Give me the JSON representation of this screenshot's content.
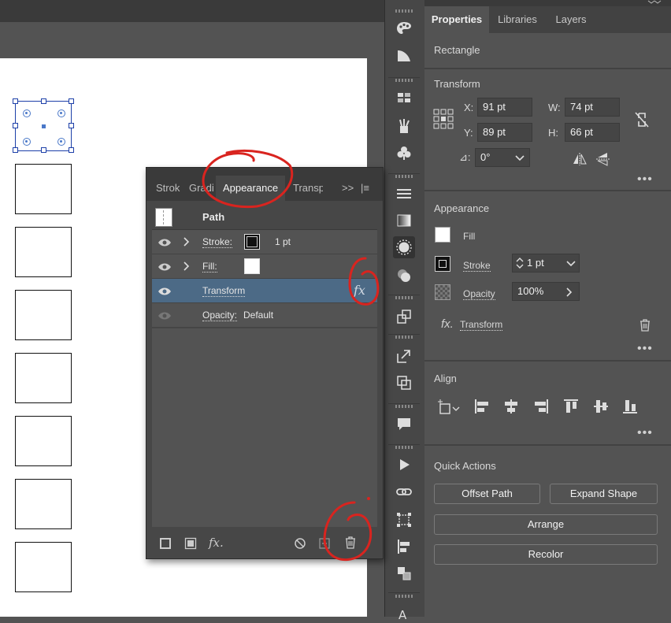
{
  "toolbar": {
    "icons": [
      "paint-palette-icon",
      "gradient-swatch-icon",
      "artboard-grid-icon",
      "brushes-icon",
      "symbols-icon",
      "align-lines-icon",
      "gradient-icon",
      "appearance-icon",
      "graphic-styles-icon",
      "transform-icon",
      "export-icon",
      "pathfinder-icon",
      "comment-icon",
      "play-icon",
      "links-icon",
      "transform-box-icon",
      "align-icon",
      "arrange-icon",
      "type-icon"
    ]
  },
  "appearance_panel": {
    "tabs": [
      "Strok",
      "Gradi",
      "Appearance",
      "Transp"
    ],
    "active_tab": "Appearance",
    "expand_label": ">>",
    "menu_label": "|≡",
    "path_label": "Path",
    "rows": [
      {
        "label": "Stroke:",
        "value": "1 pt"
      },
      {
        "label": "Fill:",
        "value": ""
      },
      {
        "label": "Transform",
        "value": ""
      },
      {
        "label": "Opacity:",
        "value": "Default"
      }
    ],
    "fx_label": "fx",
    "footer_fx_label": "fx."
  },
  "properties": {
    "tabs": [
      "Properties",
      "Libraries",
      "Layers"
    ],
    "active_tab": "Properties",
    "object_type": "Rectangle",
    "transform": {
      "title": "Transform",
      "x_label": "X:",
      "x": "91 pt",
      "y_label": "Y:",
      "y": "89 pt",
      "w_label": "W:",
      "w": "74 pt",
      "h_label": "H:",
      "h": "66 pt",
      "angle_label": "⊿:",
      "angle": "0°"
    },
    "appearance": {
      "title": "Appearance",
      "fill_label": "Fill",
      "stroke_label": "Stroke",
      "stroke_value": "1 pt",
      "opacity_label": "Opacity",
      "opacity_value": "100%",
      "effect_label": "Transform",
      "fx_label": "fx."
    },
    "align": {
      "title": "Align"
    },
    "quick_actions": {
      "title": "Quick Actions",
      "offset_path": "Offset Path",
      "expand_shape": "Expand Shape",
      "arrange": "Arrange",
      "recolor": "Recolor"
    },
    "more_label": "•••"
  },
  "colors": {
    "annotation_red": "#d9241f",
    "selection_blue": "#1c3fa8",
    "selected_row": "#4c6a86"
  }
}
